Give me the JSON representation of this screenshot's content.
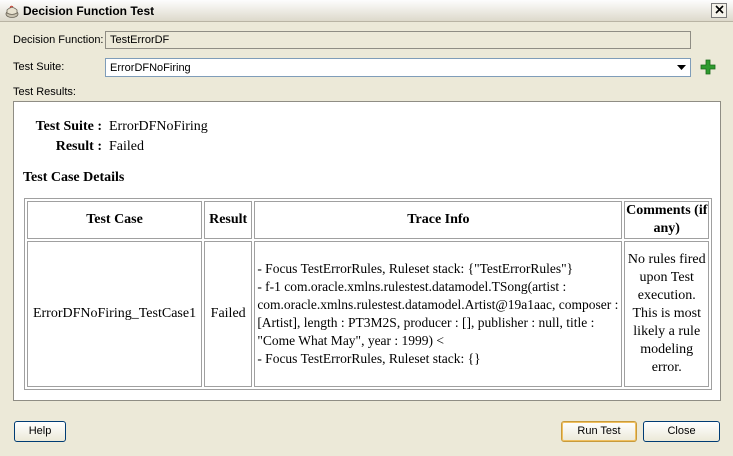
{
  "window": {
    "title": "Decision Function Test"
  },
  "form": {
    "decision_function_label": "Decision Function:",
    "decision_function_value": "TestErrorDF",
    "test_suite_label": "Test Suite:",
    "test_suite_value": "ErrorDFNoFiring",
    "test_results_label": "Test Results:"
  },
  "results": {
    "suite_key": "Test Suite :",
    "suite_value": "ErrorDFNoFiring",
    "result_key": "Result :",
    "result_value": "Failed",
    "section_title": "Test Case Details",
    "columns": [
      "Test Case",
      "Result",
      "Trace Info",
      "Comments (if any)"
    ],
    "rows": [
      {
        "test_case": "ErrorDFNoFiring_TestCase1",
        "result": "Failed",
        "trace_lines": [
          "- Focus TestErrorRules, Ruleset stack: {\"TestErrorRules\"}",
          "- f-1 com.oracle.xmlns.rulestest.datamodel.TSong(artist : com.oracle.xmlns.rulestest.datamodel.Artist@19a1aac, composer : [Artist], length : PT3M2S, producer : [], publisher : null, title : \"Come What May\", year : 1999) <",
          "- Focus TestErrorRules, Ruleset stack: {}"
        ],
        "comments": "No rules fired upon Test execution. This is most likely a rule modeling error."
      }
    ]
  },
  "buttons": {
    "help": "Help",
    "run_test": "Run Test",
    "close": "Close"
  },
  "icons": {
    "app": "oracle-coffee-cup-icon",
    "close": "close-icon",
    "dropdown": "chevron-down-icon",
    "add": "plus-icon"
  },
  "colors": {
    "add_icon": "#2e9b2e",
    "dialog_bg": "#ece9d8"
  }
}
